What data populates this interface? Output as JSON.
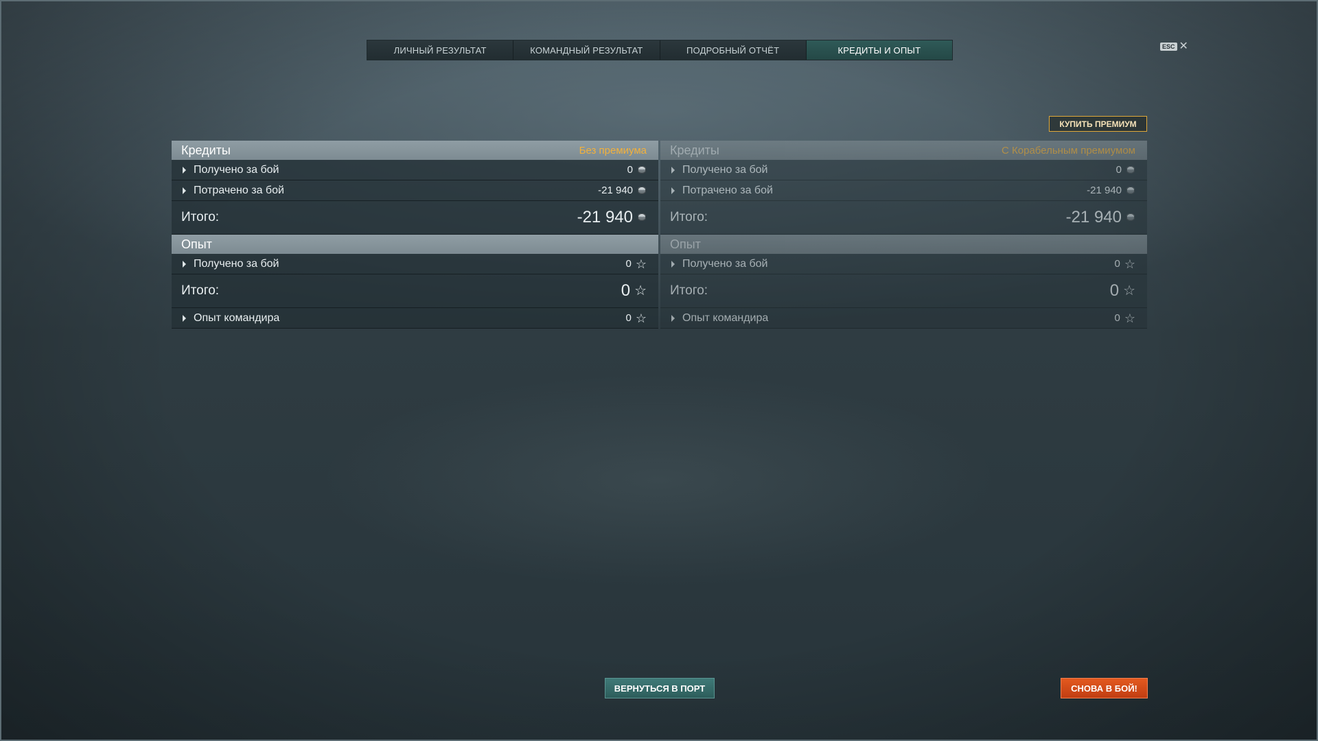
{
  "tabs": [
    {
      "label": "ЛИЧНЫЙ РЕЗУЛЬТАТ",
      "active": false
    },
    {
      "label": "КОМАНДНЫЙ РЕЗУЛЬТАТ",
      "active": false
    },
    {
      "label": "ПОДРОБНЫЙ ОТЧЁТ",
      "active": false
    },
    {
      "label": "КРЕДИТЫ И ОПЫТ",
      "active": true
    }
  ],
  "close": {
    "key": "ESC",
    "glyph": "✕"
  },
  "buy_premium_label": "КУПИТЬ ПРЕМИУМ",
  "left": {
    "credits": {
      "title": "Кредиты",
      "premium_label": "Без премиума",
      "earned_label": "Получено за бой",
      "earned_value": "0",
      "spent_label": "Потрачено за бой",
      "spent_value": "-21 940",
      "total_label": "Итого:",
      "total_value": "-21 940"
    },
    "xp": {
      "title": "Опыт",
      "earned_label": "Получено за бой",
      "earned_value": "0",
      "total_label": "Итого:",
      "total_value": "0",
      "commander_label": "Опыт командира",
      "commander_value": "0"
    }
  },
  "right": {
    "credits": {
      "title": "Кредиты",
      "premium_label": "С Корабельным премиумом",
      "earned_label": "Получено за бой",
      "earned_value": "0",
      "spent_label": "Потрачено за бой",
      "spent_value": "-21 940",
      "total_label": "Итого:",
      "total_value": "-21 940"
    },
    "xp": {
      "title": "Опыт",
      "earned_label": "Получено за бой",
      "earned_value": "0",
      "total_label": "Итого:",
      "total_value": "0",
      "commander_label": "Опыт командира",
      "commander_value": "0"
    }
  },
  "buttons": {
    "return_to_port": "ВЕРНУТЬСЯ В ПОРТ",
    "battle_again": "СНОВА В БОЙ!"
  },
  "icons": {
    "credits": "credit-coin-icon",
    "xp": "star-icon",
    "expand": "caret-right-icon",
    "close": "close-icon"
  },
  "colors": {
    "active_tab": "#2f5a58",
    "premium_label": "#f2b13c",
    "buy_premium_border": "#e0a93a",
    "return_button": "#3f7a78",
    "battle_button": "#e35a1f"
  }
}
